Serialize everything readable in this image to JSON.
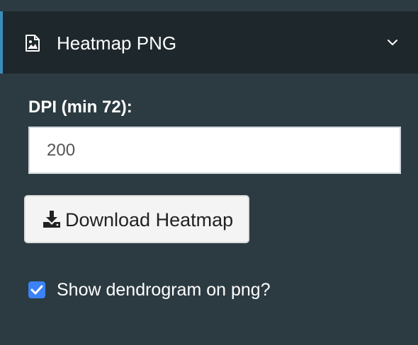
{
  "panel": {
    "title": "Heatmap PNG",
    "header_icon": "image-icon",
    "toggle_icon": "chevron-down-icon",
    "accent_color": "#3c8dbc"
  },
  "dpi": {
    "label": "DPI (min 72):",
    "value": "200"
  },
  "download": {
    "label": "Download Heatmap",
    "icon": "download-icon"
  },
  "dendrogram": {
    "label": "Show dendrogram on png?",
    "checked": true,
    "check_color": "#3b82f6"
  }
}
